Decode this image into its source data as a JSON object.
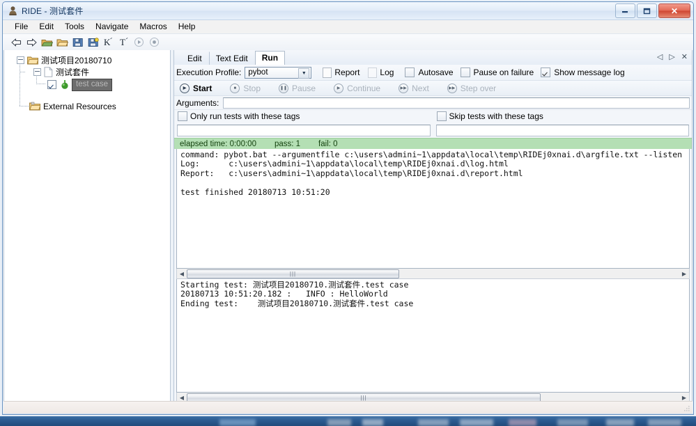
{
  "window": {
    "title": "RIDE - 测试套件",
    "icon": "app-icon",
    "buttons": {
      "minimize": "—",
      "maximize": "❐",
      "close": "✕"
    }
  },
  "menubar": {
    "items": [
      "File",
      "Edit",
      "Tools",
      "Navigate",
      "Macros",
      "Help"
    ]
  },
  "toolbar": {
    "items": [
      {
        "name": "back-icon",
        "glyph": "⇦"
      },
      {
        "name": "forward-icon",
        "glyph": "⇨"
      },
      {
        "name": "open-directory-icon",
        "glyph": "📂"
      },
      {
        "name": "open-file-icon",
        "glyph": "📁"
      },
      {
        "name": "save-icon",
        "glyph": "💾"
      },
      {
        "name": "save-all-icon",
        "glyph": "💾"
      },
      {
        "name": "search-keyword-icon",
        "glyph": "K"
      },
      {
        "name": "search-tests-icon",
        "glyph": "T"
      },
      {
        "name": "run-icon",
        "glyph": "▸"
      },
      {
        "name": "debug-icon",
        "glyph": "◉"
      }
    ]
  },
  "tree": {
    "project": "测试项目20180710",
    "suite": "测试套件",
    "test_case": "test case",
    "external_resources": "External Resources"
  },
  "tabs": {
    "items": [
      {
        "label": "Edit",
        "active": false
      },
      {
        "label": "Text Edit",
        "active": false
      },
      {
        "label": "Run",
        "active": true
      }
    ],
    "nav": {
      "prev": "◁",
      "next": "▷",
      "close": "✕"
    }
  },
  "run": {
    "profile_label": "Execution Profile:",
    "profile_value": "pybot",
    "report_label": "Report",
    "log_label": "Log",
    "autosave_label": "Autosave",
    "autosave_checked": false,
    "pause_on_failure_label": "Pause on failure",
    "pause_on_failure_checked": false,
    "show_message_log_label": "Show message log",
    "show_message_log_checked": true,
    "controls": [
      {
        "label": "Start",
        "enabled": true,
        "icon": "play-icon",
        "glyph": "▸"
      },
      {
        "label": "Stop",
        "enabled": false,
        "icon": "stop-icon",
        "glyph": "■"
      },
      {
        "label": "Pause",
        "enabled": false,
        "icon": "pause-icon",
        "glyph": "❚❚"
      },
      {
        "label": "Continue",
        "enabled": false,
        "icon": "continue-icon",
        "glyph": "▸"
      },
      {
        "label": "Next",
        "enabled": false,
        "icon": "next-icon",
        "glyph": "▸▸"
      },
      {
        "label": "Step over",
        "enabled": false,
        "icon": "step-over-icon",
        "glyph": "▸▸"
      }
    ],
    "arguments_label": "Arguments:",
    "arguments_value": "",
    "only_run_tags_label": "Only run tests with these tags",
    "only_run_tags_checked": false,
    "only_run_tags_value": "",
    "skip_tags_label": "Skip tests with these tags",
    "skip_tags_checked": false,
    "skip_tags_value": "",
    "status": {
      "elapsed": "elapsed time: 0:00:00",
      "pass": "pass: 1",
      "fail": "fail: 0"
    },
    "console_top": "command: pybot.bat --argumentfile c:\\users\\admini~1\\appdata\\local\\temp\\RIDEj0xnai.d\\argfile.txt --listen\nLog:      c:\\users\\admini~1\\appdata\\local\\temp\\RIDEj0xnai.d\\log.html\nReport:   c:\\users\\admini~1\\appdata\\local\\temp\\RIDEj0xnai.d\\report.html\n\ntest finished 20180713 10:51:20",
    "console_bottom": "Starting test: 测试项目20180710.测试套件.test case\n20180713 10:51:20.182 :   INFO : HelloWorld\nEnding test:    测试项目20180710.测试套件.test case"
  },
  "colors": {
    "status_green": "#b4dfb4",
    "selection_gray": "#6e6e6e",
    "accent_blue": "#6a93c0"
  }
}
